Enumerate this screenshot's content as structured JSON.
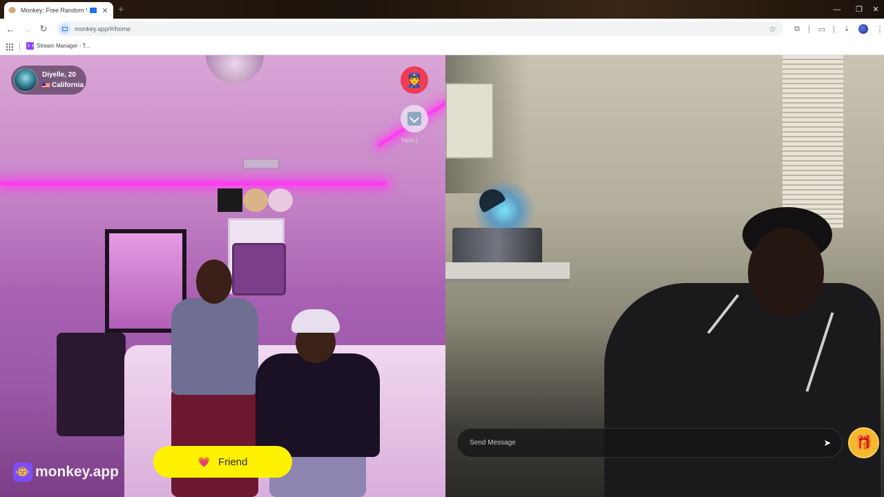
{
  "browser": {
    "tab_title": "Monkey: Free Random Vide",
    "url": "monkey.app/#/home",
    "bookmark_label": "Stream Manager - T..."
  },
  "left_video": {
    "user_name": "Diyelle, 20",
    "user_location": "California",
    "next_label": "Next (",
    "friend_label": "Friend"
  },
  "brand": {
    "name": "monkey.app"
  },
  "right_video": {
    "message_placeholder": "Send Message"
  },
  "colors": {
    "friend_button": "#fff200",
    "report_button": "#ef3d57",
    "gift_button": "#f5b82e",
    "brand_logo": "#7c4dff"
  },
  "icons": {
    "report": "police-officer-icon",
    "next": "next-match-icon",
    "friend": "heart-icon",
    "send": "send-icon",
    "gift": "gift-icon"
  }
}
